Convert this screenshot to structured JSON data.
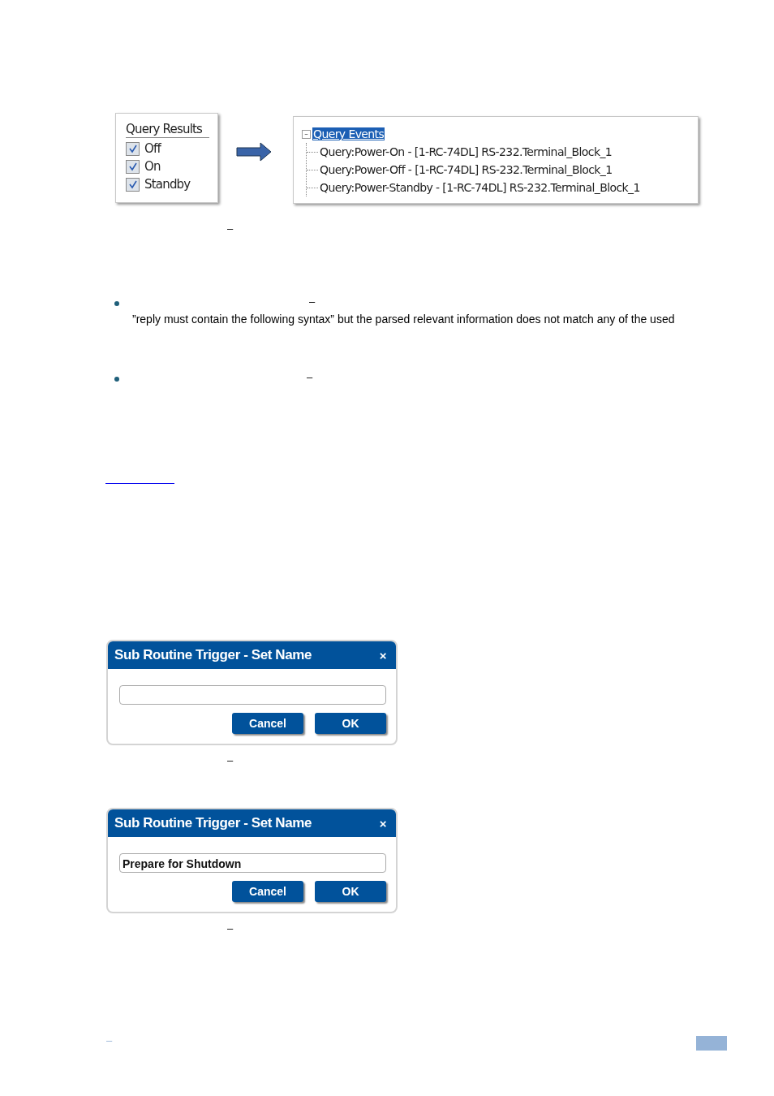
{
  "figure": {
    "query_results": {
      "title": "Query Results",
      "options": [
        {
          "label": "Off",
          "checked": true
        },
        {
          "label": "On",
          "checked": true
        },
        {
          "label": "Standby",
          "checked": true
        }
      ]
    },
    "query_events": {
      "label": "Query Events",
      "expanded": true,
      "selected": true,
      "toggle": "–",
      "children": [
        {
          "label": "Query:Power-On - [1-RC-74DL] RS-232.Terminal_Block_1"
        },
        {
          "label": "Query:Power-Off - [1-RC-74DL] RS-232.Terminal_Block_1"
        },
        {
          "label": "Query:Power-Standby - [1-RC-74DL] RS-232.Terminal_Block_1"
        }
      ]
    }
  },
  "caption_1": "–",
  "bullets": [
    {
      "dash": "–",
      "text": "”reply must contain the following syntax” but the parsed relevant information does not match any of the used"
    },
    {
      "dash": "–"
    }
  ],
  "dialogs": [
    {
      "title": "Sub Routine Trigger - Set Name",
      "close": "×",
      "buttons": [
        "Cancel",
        "OK"
      ],
      "caption": "–"
    },
    {
      "title": "Sub Routine Trigger - Set Name",
      "close": "×",
      "value": "Prepare for Shutdown",
      "buttons": [
        "Cancel",
        "OK"
      ],
      "caption": "–"
    }
  ],
  "footer": {
    "dash": "–"
  }
}
